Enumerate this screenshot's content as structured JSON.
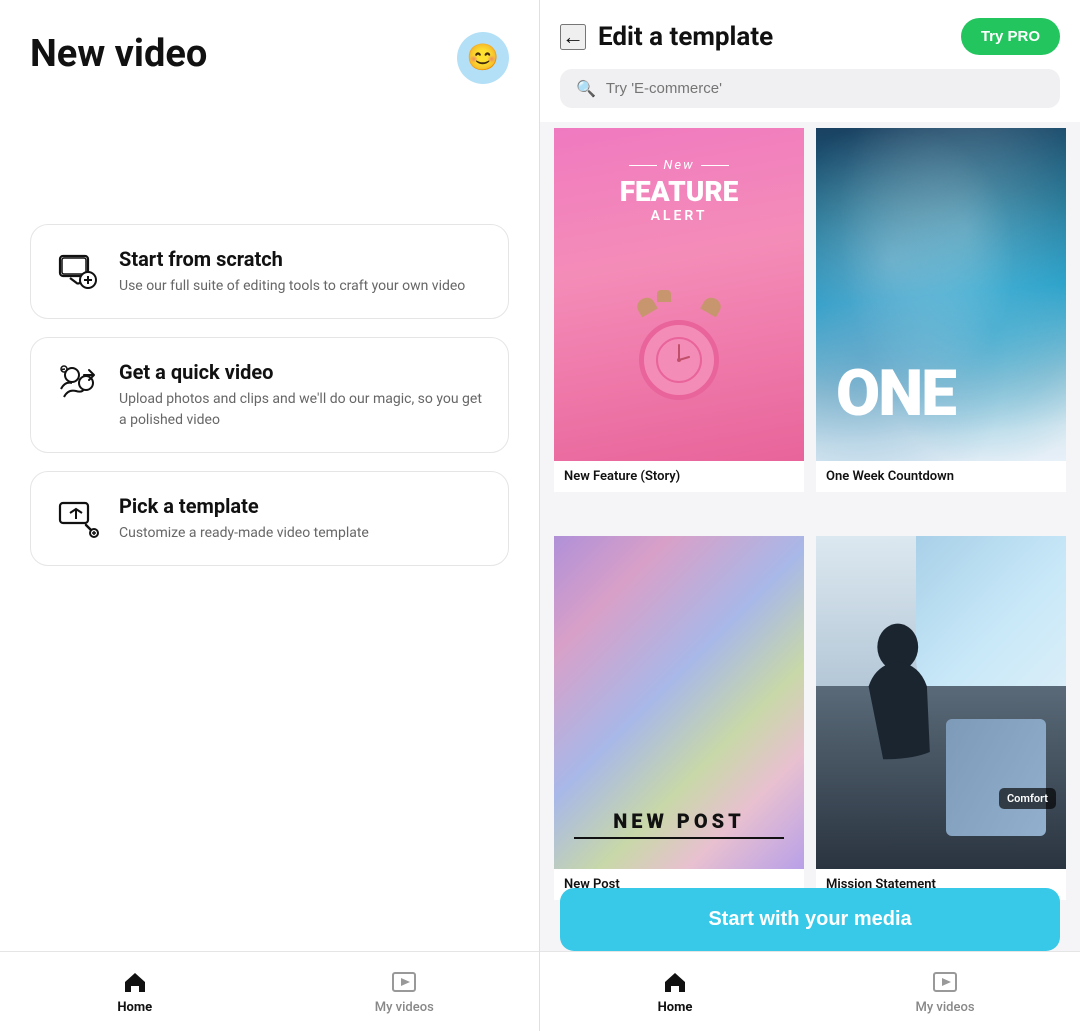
{
  "left": {
    "title": "New video",
    "avatar_icon": "😊",
    "options": [
      {
        "id": "scratch",
        "title": "Start from scratch",
        "desc": "Use our full suite of editing tools to craft your own video"
      },
      {
        "id": "quick",
        "title": "Get a quick video",
        "desc": "Upload photos and clips and we'll do our magic, so you get a polished video"
      },
      {
        "id": "template",
        "title": "Pick a template",
        "desc": "Customize a ready-made video template"
      }
    ],
    "nav": {
      "home_label": "Home",
      "myvideos_label": "My videos"
    }
  },
  "right": {
    "back_label": "←",
    "title": "Edit a template",
    "try_pro_label": "Try PRO",
    "search_placeholder": "Try 'E-commerce'",
    "templates": [
      {
        "id": "new-feature",
        "name": "New Feature (Story)",
        "theme": "pink",
        "overlay_new": "New",
        "overlay_main": "FEATURE",
        "overlay_sub": "ALERT"
      },
      {
        "id": "one-week",
        "name": "One Week Countdown",
        "theme": "ocean",
        "overlay_text": "ONE"
      },
      {
        "id": "new-post",
        "name": "New Post",
        "theme": "iridescent",
        "overlay_text": "NEW POST"
      },
      {
        "id": "mission",
        "name": "Mission Statement",
        "theme": "car",
        "comfort_label": "Comfort"
      }
    ],
    "start_media_label": "Start with your media",
    "nav": {
      "home_label": "Home",
      "myvideos_label": "My videos"
    }
  }
}
